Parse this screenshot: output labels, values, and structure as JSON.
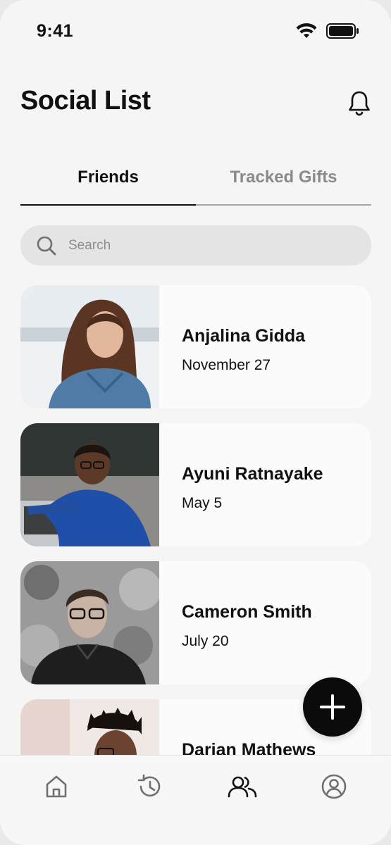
{
  "status_bar": {
    "time": "9:41",
    "icons": [
      "wifi-icon",
      "battery-icon"
    ]
  },
  "header": {
    "title": "Social List",
    "icon": "bell-icon"
  },
  "tabs": [
    {
      "label": "Friends",
      "active": true
    },
    {
      "label": "Tracked Gifts",
      "active": false
    }
  ],
  "search": {
    "placeholder": "Search",
    "value": ""
  },
  "friends": [
    {
      "name": "Anjalina Gidda",
      "date": "November 27"
    },
    {
      "name": "Ayuni Ratnayake",
      "date": "May 5"
    },
    {
      "name": "Cameron Smith",
      "date": "July 20"
    },
    {
      "name": "Darian Mathews",
      "date": ""
    }
  ],
  "fab": {
    "icon": "plus-icon"
  },
  "bottom_nav": {
    "items": [
      {
        "icon": "home-icon",
        "active": false
      },
      {
        "icon": "history-icon",
        "active": false
      },
      {
        "icon": "friends-icon",
        "active": true
      },
      {
        "icon": "profile-icon",
        "active": false
      }
    ]
  },
  "colors": {
    "background": "#f5f5f5",
    "card": "#fbfbfc",
    "text": "#111111",
    "inactive_tab": "#8a8a8a",
    "fab": "#0b0b0b"
  }
}
